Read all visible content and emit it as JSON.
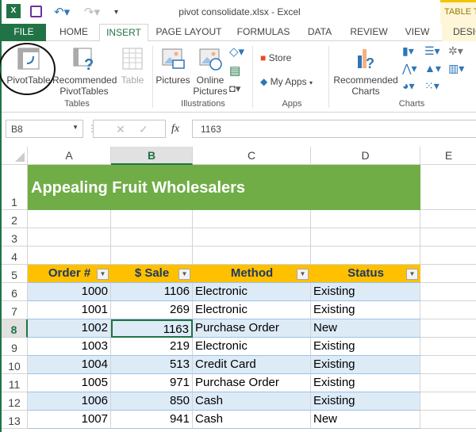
{
  "window": {
    "title": "pivot consolidate.xlsx - Excel",
    "contextual_tab": "TABLE TOOLS"
  },
  "tabs": [
    "FILE",
    "HOME",
    "INSERT",
    "PAGE LAYOUT",
    "FORMULAS",
    "DATA",
    "REVIEW",
    "VIEW",
    "DESIGN"
  ],
  "ribbon": {
    "pivottable": "PivotTable",
    "recommended_pivot": [
      "Recommended",
      "PivotTables"
    ],
    "table": "Table",
    "pictures": "Pictures",
    "online_pictures": [
      "Online",
      "Pictures"
    ],
    "store": "Store",
    "my_apps": "My Apps",
    "recommended_charts": [
      "Recommended",
      "Charts"
    ],
    "groups": {
      "tables": "Tables",
      "illustrations": "Illustrations",
      "apps": "Apps",
      "charts": "Charts"
    }
  },
  "formula_bar": {
    "name_box": "B8",
    "fx": "fx",
    "value": "1163"
  },
  "columns": [
    "A",
    "B",
    "C",
    "D",
    "E"
  ],
  "rows": [
    "1",
    "2",
    "3",
    "4",
    "5",
    "6",
    "7",
    "8",
    "9",
    "10",
    "11",
    "12",
    "13"
  ],
  "sheet": {
    "title": "Appealing Fruit Wholesalers",
    "headers": [
      "Order #",
      "$ Sale",
      "Method",
      "Status"
    ],
    "data": [
      [
        "1000",
        "1106",
        "Electronic",
        "Existing"
      ],
      [
        "1001",
        "269",
        "Electronic",
        "Existing"
      ],
      [
        "1002",
        "1163",
        "Purchase Order",
        "New"
      ],
      [
        "1003",
        "219",
        "Electronic",
        "Existing"
      ],
      [
        "1004",
        "513",
        "Credit Card",
        "Existing"
      ],
      [
        "1005",
        "971",
        "Purchase Order",
        "Existing"
      ],
      [
        "1006",
        "850",
        "Cash",
        "Existing"
      ],
      [
        "1007",
        "941",
        "Cash",
        "New"
      ]
    ]
  }
}
